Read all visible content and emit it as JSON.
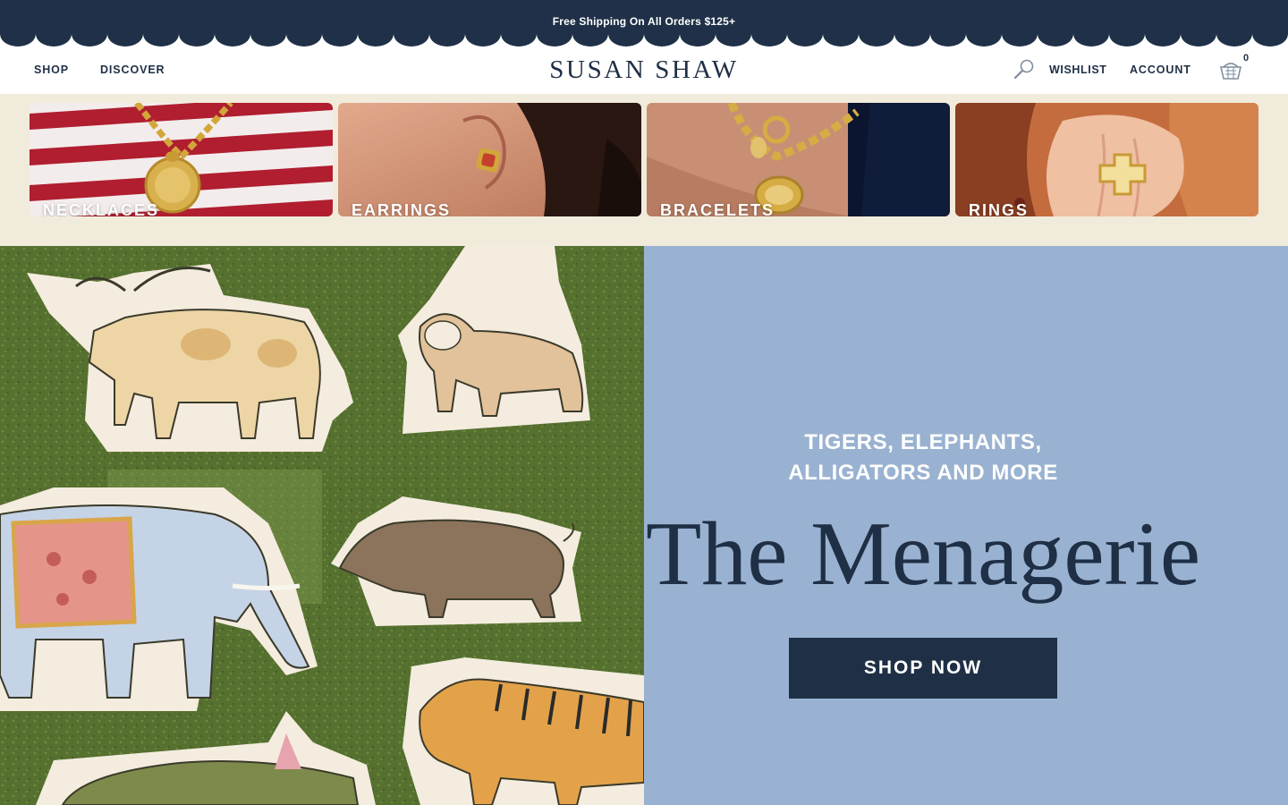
{
  "announcement": {
    "text": "Free Shipping On All Orders $125+"
  },
  "header": {
    "nav_left": [
      "SHOP",
      "DISCOVER"
    ],
    "logo": "SUSAN SHAW",
    "search_icon": "search-icon",
    "wishlist_label": "WISHLIST",
    "account_label": "ACCOUNT",
    "cart_icon": "shopping-basket-icon",
    "cart_count": "0"
  },
  "categories": [
    {
      "label": "NECKLACES"
    },
    {
      "label": "EARRINGS"
    },
    {
      "label": "BRACELETS"
    },
    {
      "label": "RINGS"
    }
  ],
  "hero": {
    "eyebrow_line1": "TIGERS, ELEPHANTS,",
    "eyebrow_line2": "ALLIGATORS AND MORE",
    "title": "The Menagerie",
    "cta_label": "SHOP NOW"
  },
  "colors": {
    "navy": "#1f3048",
    "cream": "#f1ebdb",
    "hero_blue": "#9ab2d1",
    "white": "#ffffff"
  }
}
